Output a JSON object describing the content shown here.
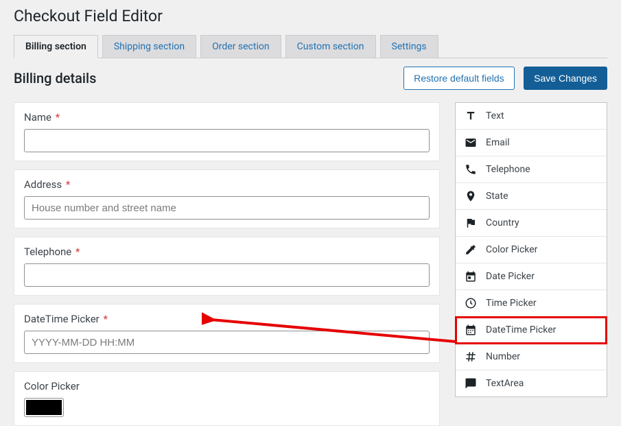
{
  "page_title": "Checkout Field Editor",
  "tabs": {
    "billing": "Billing section",
    "shipping": "Shipping section",
    "order": "Order section",
    "custom": "Custom section",
    "settings": "Settings"
  },
  "subtitle": "Billing details",
  "buttons": {
    "restore": "Restore default fields",
    "save": "Save Changes"
  },
  "fields": {
    "name": {
      "label": "Name",
      "required": "*"
    },
    "address": {
      "label": "Address",
      "required": "*",
      "placeholder": "House number and street name"
    },
    "telephone": {
      "label": "Telephone",
      "required": "*"
    },
    "datetime": {
      "label": "DateTime Picker",
      "required": "*",
      "placeholder": "YYYY-MM-DD HH:MM"
    },
    "colorpicker": {
      "label": "Color Picker"
    }
  },
  "sidebar": {
    "items": [
      {
        "label": "Text"
      },
      {
        "label": "Email"
      },
      {
        "label": "Telephone"
      },
      {
        "label": "State"
      },
      {
        "label": "Country"
      },
      {
        "label": "Color Picker"
      },
      {
        "label": "Date Picker"
      },
      {
        "label": "Time Picker"
      },
      {
        "label": "DateTime Picker"
      },
      {
        "label": "Number"
      },
      {
        "label": "TextArea"
      }
    ]
  }
}
